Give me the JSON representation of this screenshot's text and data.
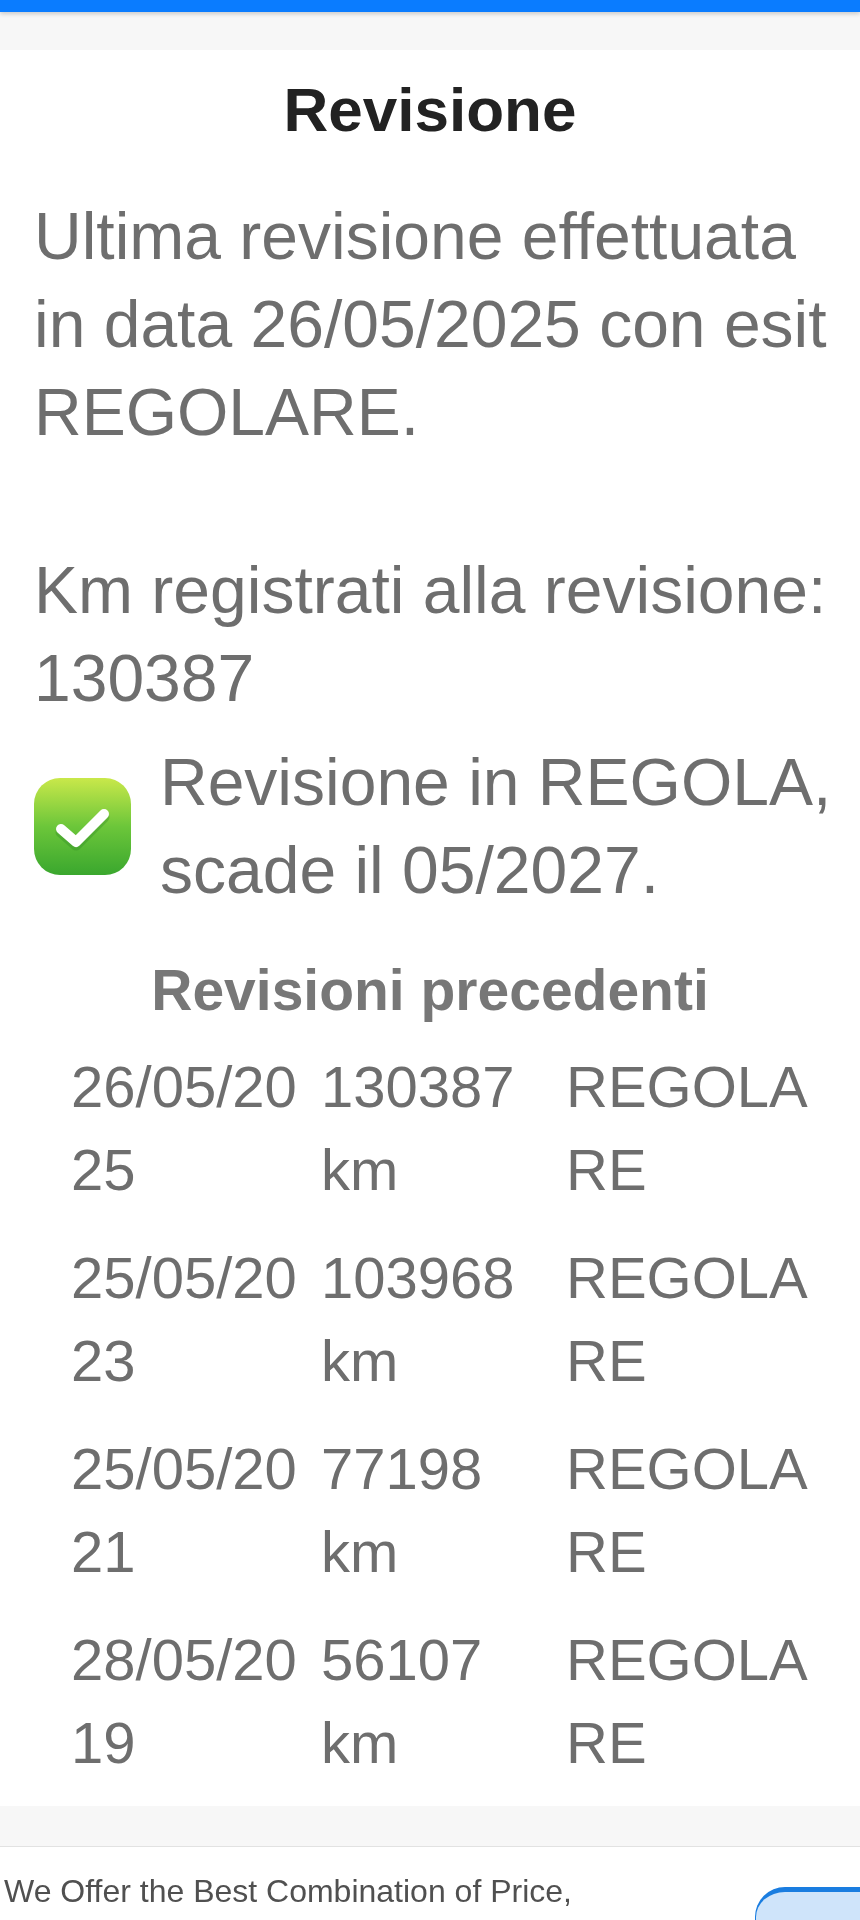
{
  "card": {
    "title": "Revisione",
    "last_revision": [
      "Ultima revisione effettuata",
      "in data 26/05/2025 con esit",
      "REGOLARE."
    ],
    "mileage": [
      "Km registrati alla revisione:",
      "130387"
    ],
    "status": [
      "Revisione in REGOLA,",
      "scade il 05/2027."
    ],
    "previous": {
      "title": "Revisioni precedenti",
      "rows": [
        {
          "date": "26/05/2025",
          "km": "130387 km",
          "result": "REGOLARE"
        },
        {
          "date": "25/05/2023",
          "km": "103968 km",
          "result": "REGOLARE"
        },
        {
          "date": "25/05/2021",
          "km": "77198 km",
          "result": "REGOLARE"
        },
        {
          "date": "28/05/2019",
          "km": "56107 km",
          "result": "REGOLARE"
        }
      ]
    }
  },
  "ad": {
    "text": "We Offer the Best Combination of Price,"
  }
}
